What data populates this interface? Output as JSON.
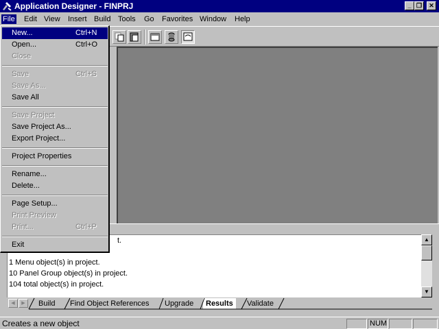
{
  "window": {
    "title": "Application Designer - FINPRJ",
    "minimize": "_",
    "restore": "❐",
    "close": "✕"
  },
  "menubar": [
    "File",
    "Edit",
    "View",
    "Insert",
    "Build",
    "Tools",
    "Go",
    "Favorites",
    "Window",
    "Help"
  ],
  "file_menu": {
    "new": {
      "label": "New...",
      "shortcut": "Ctrl+N"
    },
    "open": {
      "label": "Open...",
      "shortcut": "Ctrl+O"
    },
    "close": {
      "label": "Close"
    },
    "save": {
      "label": "Save",
      "shortcut": "Ctrl+S"
    },
    "save_as": {
      "label": "Save As..."
    },
    "save_all": {
      "label": "Save All"
    },
    "save_project": {
      "label": "Save Project"
    },
    "save_project_as": {
      "label": "Save Project As..."
    },
    "export_project": {
      "label": "Export Project..."
    },
    "project_properties": {
      "label": "Project Properties"
    },
    "rename": {
      "label": "Rename..."
    },
    "delete": {
      "label": "Delete..."
    },
    "page_setup": {
      "label": "Page Setup..."
    },
    "print_preview": {
      "label": "Print Preview"
    },
    "print": {
      "label": "Print...",
      "shortcut": "Ctrl+P"
    },
    "exit": {
      "label": "Exit"
    }
  },
  "output": {
    "lines": [
      "t.",
      "1 Menu  object(s) in project.",
      "10 Panel Group  object(s) in project.",
      "104  total object(s) in project."
    ]
  },
  "tabs": [
    "Build",
    "Find Object References",
    "Upgrade",
    "Results",
    "Validate"
  ],
  "selected_tab": "Results",
  "status": {
    "message": "Creates a new object",
    "num": "NUM"
  },
  "colors": {
    "titlebar": "#000080",
    "face": "#c0c0c0",
    "workspace": "#808080"
  }
}
